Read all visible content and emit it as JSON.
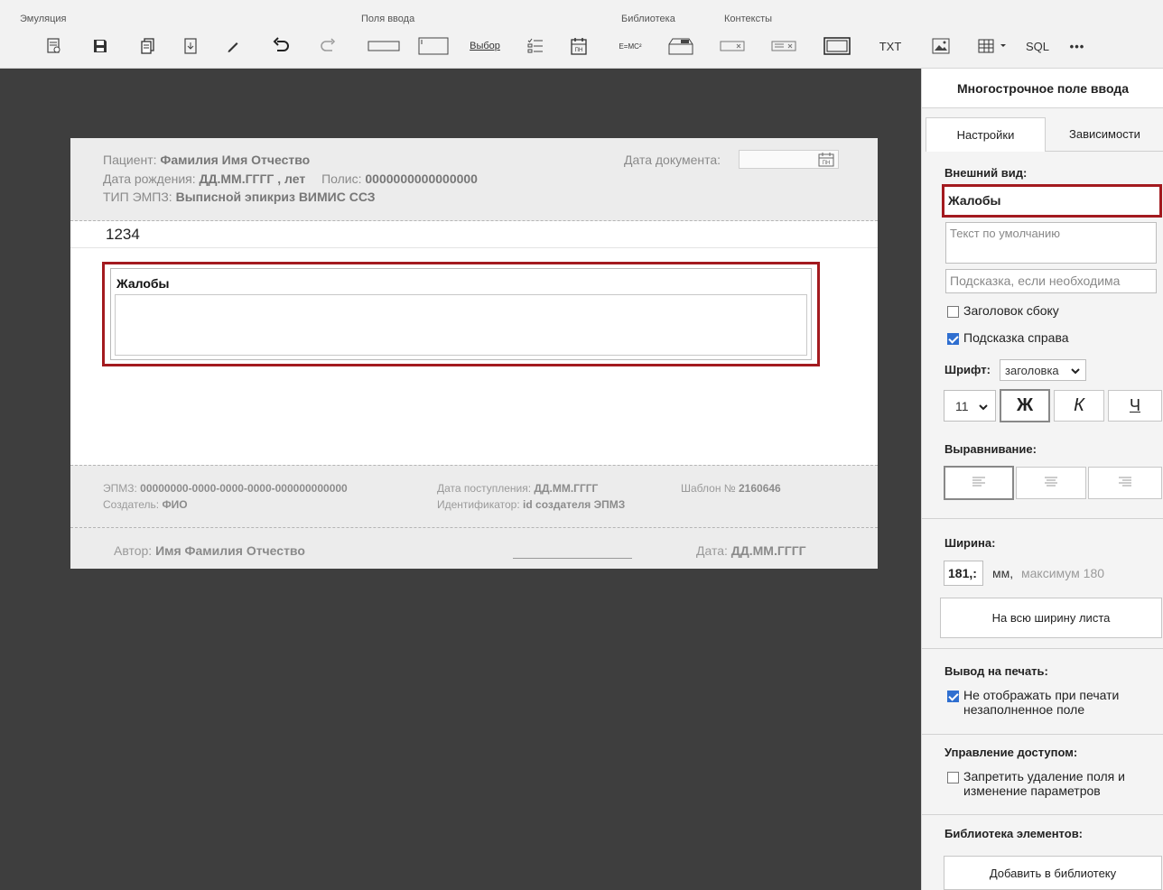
{
  "toolbar": {
    "groups": {
      "emulation": "Эмуляция",
      "input_fields": "Поля ввода",
      "library": "Библиотека",
      "contexts": "Контексты"
    },
    "select_label": "Выбор",
    "formula_label": "E=MC²",
    "txt_label": "TXT",
    "sql_label": "SQL",
    "more_label": "•••"
  },
  "document": {
    "patient_label": "Пациент:",
    "patient_value": "Фамилия Имя Отчество",
    "birth_label": "Дата рождения:",
    "birth_value": "ДД.ММ.ГГГГ , лет",
    "policy_label": "Полис:",
    "policy_value": "0000000000000000",
    "type_label": "ТИП ЭМПЗ:",
    "type_value": "Выписной эпикриз ВИМИС ССЗ",
    "date_doc_label": "Дата документа:",
    "date_icon_text": "ПН",
    "number": "1234",
    "field_label": "Жалобы"
  },
  "footer": {
    "empz_label": "ЭПМЗ:",
    "empz_value": "00000000-0000-0000-0000-000000000000",
    "creator_label": "Создатель:",
    "creator_value": "ФИО",
    "received_label": "Дата поступления:",
    "received_value": "ДД.ММ.ГГГГ",
    "id_label": "Идентификатор:",
    "id_value": "id создателя ЭПМЗ",
    "template_label": "Шаблон №",
    "template_value": "2160646",
    "author_label": "Автор:",
    "author_value": "Имя Фамилия Отчество",
    "date_label": "Дата:",
    "date_value": "ДД.ММ.ГГГГ"
  },
  "panel": {
    "title": "Многострочное поле ввода",
    "tabs": [
      "Настройки",
      "Зависимости"
    ],
    "appearance_title": "Внешний вид:",
    "title_value": "Жалобы",
    "default_text_placeholder": "Текст по умолчанию",
    "hint_placeholder": "Подсказка, если необходима",
    "check_side_title": "Заголовок сбоку",
    "check_hint_right": "Подсказка справа",
    "font_label": "Шрифт:",
    "font_value": "заголовка",
    "font_size": "11",
    "bold": "Ж",
    "italic": "К",
    "underline": "Ч",
    "align_title": "Выравнивание:",
    "width_title": "Ширина:",
    "width_value": "181,:",
    "width_unit": "мм,",
    "width_max": "максимум 180",
    "full_width_button": "На всю ширину листа",
    "print_title": "Вывод на печать:",
    "print_check_line1": "Не отображать при печати",
    "print_check_line2": "незаполненное поле",
    "access_title": "Управление доступом:",
    "access_check_line1": "Запретить удаление поля и",
    "access_check_line2": "изменение параметров",
    "library_title": "Библиотека элементов:",
    "add_library_button": "Добавить в библиотеку"
  },
  "colors": {
    "highlight": "#a31a1f",
    "checkbox": "#2f6fd0",
    "workspace": "#3e3e3e"
  }
}
